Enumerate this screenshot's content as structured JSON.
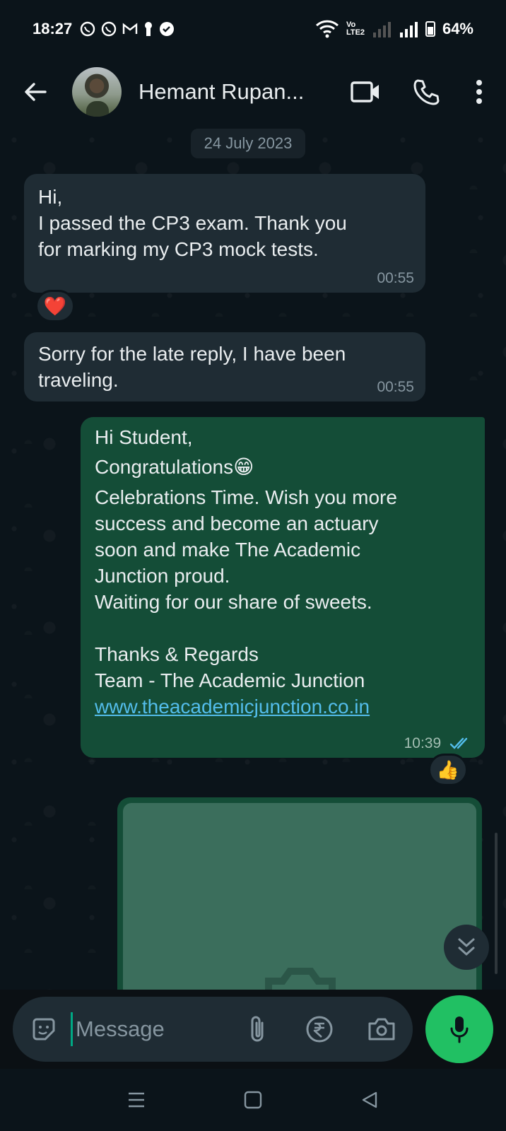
{
  "status_bar": {
    "time": "18:27",
    "network_label": "Vo LTE2",
    "battery": "64%"
  },
  "header": {
    "contact_name": "Hemant Rupan...",
    "icons": [
      "back-arrow-icon",
      "video-call-icon",
      "phone-icon",
      "more-vert-icon"
    ]
  },
  "chat": {
    "date_chip": "24 July 2023",
    "messages": [
      {
        "direction": "incoming",
        "lines": [
          "Hi,",
          "I passed the CP3 exam. Thank you",
          "for marking my CP3 mock tests."
        ],
        "time": "00:55",
        "reaction": "❤️"
      },
      {
        "direction": "incoming",
        "lines": [
          "Sorry for the late reply, I have been",
          "traveling."
        ],
        "time": "00:55"
      },
      {
        "direction": "outgoing",
        "lines": [
          "Hi Student,",
          "Congratulations😁",
          "Celebrations Time. Wish you more",
          "success and become an actuary",
          "soon and make The Academic",
          "Junction proud.",
          "Waiting for our share of sweets.",
          "",
          "Thanks & Regards",
          "Team - The Academic Junction"
        ],
        "link": "www.theacademicjunction.co.in",
        "time": "10:39",
        "status": "read",
        "reaction": "👍"
      }
    ],
    "image_message": {
      "placeholder_icon": "camera-icon"
    }
  },
  "composer": {
    "placeholder": "Message",
    "icons": [
      "sticker-icon",
      "attach-icon",
      "rupee-payment-icon",
      "camera-icon",
      "mic-icon"
    ]
  },
  "colors": {
    "background": "#0b141a",
    "incoming_bubble": "#1f2c34",
    "outgoing_bubble": "#144d37",
    "accent_green": "#21c063",
    "link": "#53bdeb",
    "read_ticks": "#53bdeb"
  }
}
